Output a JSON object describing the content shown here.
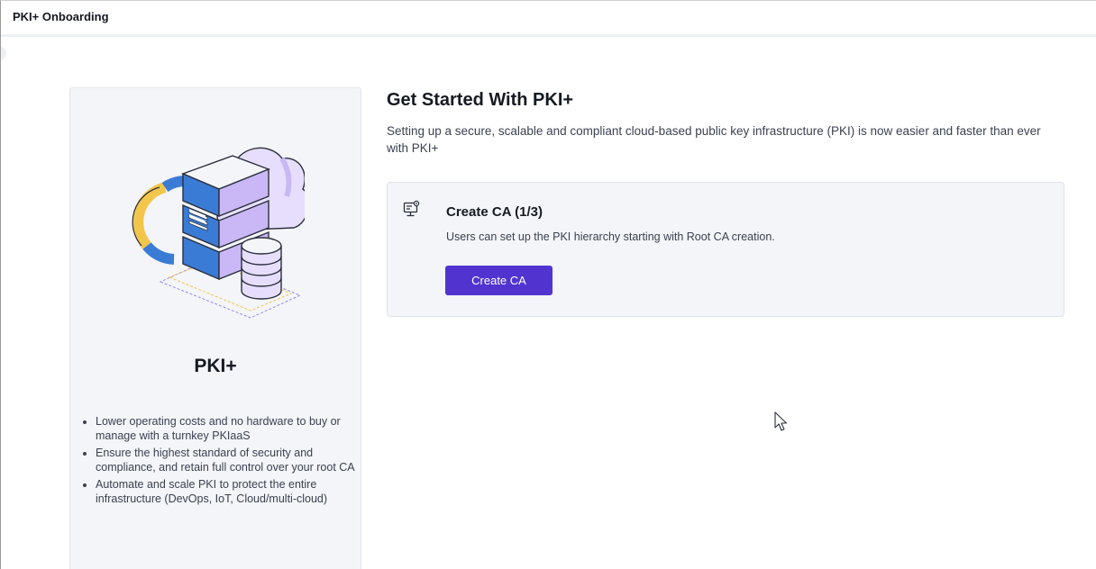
{
  "app": {
    "title": "PKI+ Onboarding"
  },
  "left_panel": {
    "illustration_icon": "server-cloud-database-illustration",
    "product_name": "PKI+",
    "features": [
      "Lower operating costs and no hardware to buy or manage with a turnkey PKIaaS",
      "Ensure the highest standard of security and compliance, and retain full control over your root CA",
      "Automate and scale PKI to protect the entire infrastructure (DevOps, IoT, Cloud/multi-cloud)"
    ]
  },
  "main": {
    "title": "Get Started With PKI+",
    "description": "Setting up a secure, scalable and compliant cloud-based public key infrastructure (PKI) is now easier and faster than ever with PKI+",
    "step": {
      "icon": "monitor-settings-icon",
      "title": "Create CA (1/3)",
      "description": "Users can set up the PKI hierarchy starting with Root CA creation.",
      "button_label": "Create CA"
    }
  },
  "colors": {
    "primary": "#5134d0",
    "panel_bg": "#f3f5f8",
    "illustration_purple": "#c9b8f5",
    "illustration_blue": "#3a7bd5",
    "illustration_yellow": "#f2c64b"
  }
}
